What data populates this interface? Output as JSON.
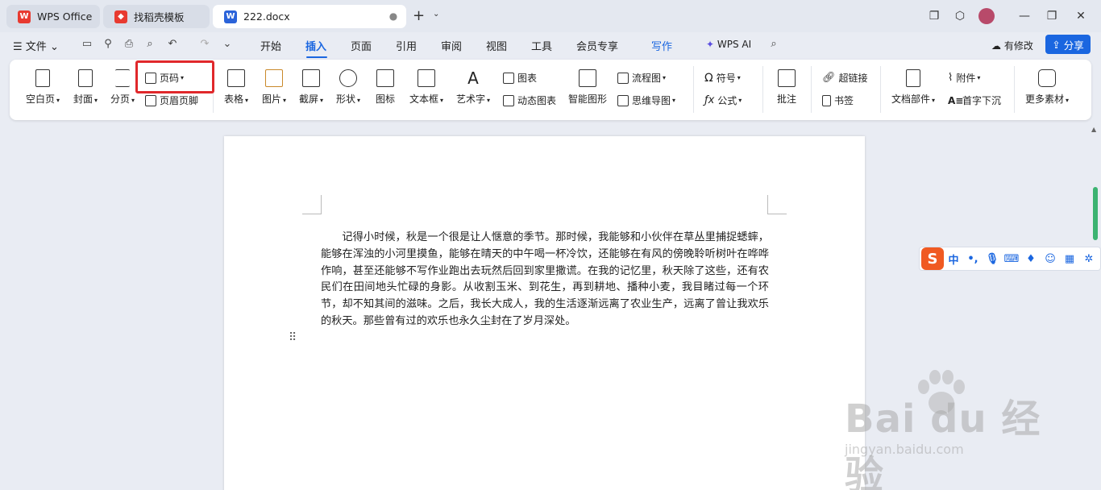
{
  "titlebar": {
    "tabs": [
      {
        "label": "WPS Office",
        "icon": "wps-logo-icon",
        "active": false
      },
      {
        "label": "找稻壳模板",
        "icon": "docer-icon",
        "active": false
      },
      {
        "label": "222.docx",
        "icon": "word-doc-icon",
        "active": true
      }
    ]
  },
  "menubar": {
    "file_label": "文件",
    "items": [
      "开始",
      "插入",
      "页面",
      "引用",
      "审阅",
      "视图",
      "工具",
      "会员专享"
    ],
    "write_label": "写作",
    "wps_ai_label": "WPS AI",
    "has_changes_label": "有修改",
    "share_label": "分享",
    "active_item": "插入"
  },
  "ribbon": {
    "blank_page": "空白页",
    "cover": "封面",
    "page_break": "分页",
    "page_number": "页码",
    "header_footer": "页眉页脚",
    "table": "表格",
    "picture": "图片",
    "screenshot": "截屏",
    "shape": "形状",
    "icon": "图标",
    "textbox": "文本框",
    "wordart": "艺术字",
    "chart": "图表",
    "dynamic_chart": "动态图表",
    "smart_graphic": "智能图形",
    "flowchart": "流程图",
    "mindmap": "思维导图",
    "symbol": "符号",
    "formula": "公式",
    "comment": "批注",
    "hyperlink": "超链接",
    "bookmark": "书签",
    "doc_parts": "文档部件",
    "attachment": "附件",
    "dropcap": "首字下沉",
    "more_materials": "更多素材"
  },
  "document": {
    "paragraph": "记得小时候，秋是一个很是让人惬意的季节。那时候，我能够和小伙伴在草丛里捕捉蟋蟀，能够在浑浊的小河里摸鱼，能够在晴天的中午喝一杯冷饮，还能够在有风的傍晚聆听树叶在哗哗作响，甚至还能够不写作业跑出去玩然后回到家里撒谎。在我的记忆里，秋天除了这些，还有农民们在田间地头忙碌的身影。从收割玉米、到花生，再到耕地、播种小麦，我目睹过每一个环节，却不知其间的滋味。之后，我长大成人，我的生活逐渐远离了农业生产，远离了曾让我欢乐的秋天。那些曾有过的欢乐也永久尘封在了岁月深处。"
  },
  "ime": {
    "logo": "S",
    "mode": "中",
    "punct": "•,"
  },
  "watermark": {
    "brand": "Bai du 经验",
    "url": "jingyan.baidu.com"
  },
  "colors": {
    "accent": "#1a66e0",
    "highlight": "#e0282b",
    "wps_red": "#e83a30",
    "scroll_thumb": "#3cb371"
  }
}
